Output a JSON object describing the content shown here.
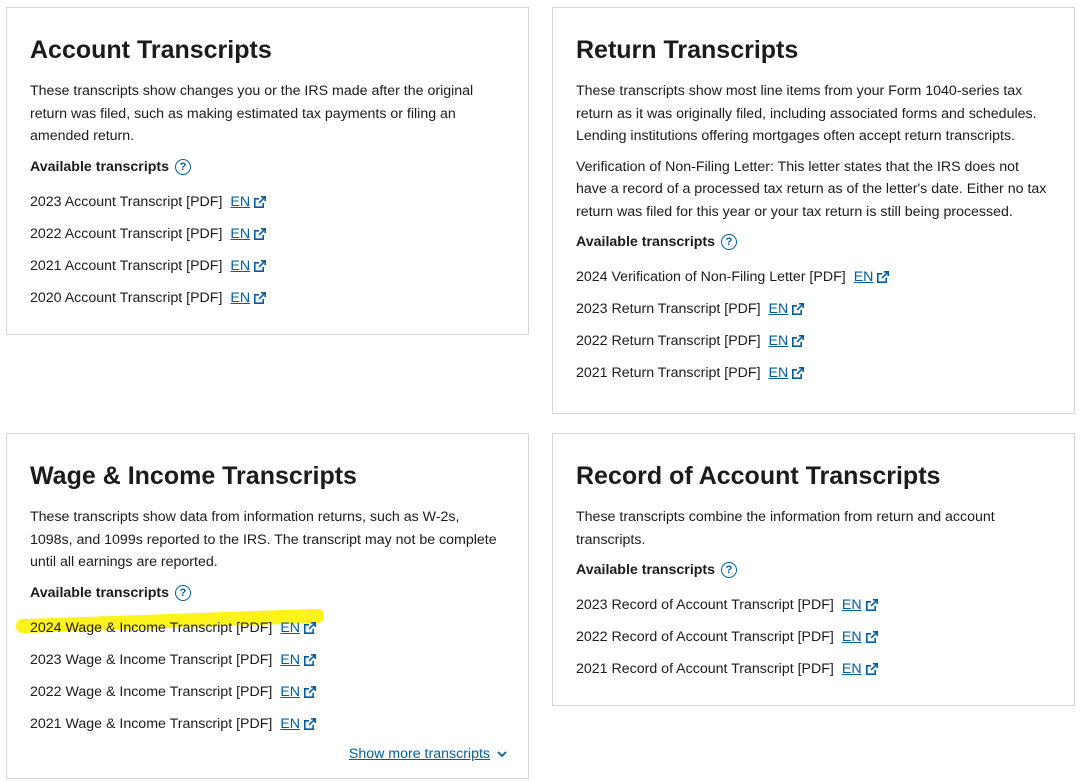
{
  "account": {
    "title": "Account Transcripts",
    "desc": "These transcripts show changes you or the IRS made after the original return was filed, such as making estimated tax payments or filing an amended return.",
    "avail_label": "Available transcripts",
    "items": [
      {
        "name": "2023 Account Transcript [PDF]",
        "link": "EN"
      },
      {
        "name": "2022 Account Transcript [PDF]",
        "link": "EN"
      },
      {
        "name": "2021 Account Transcript [PDF]",
        "link": "EN"
      },
      {
        "name": "2020 Account Transcript [PDF]",
        "link": "EN"
      }
    ]
  },
  "return": {
    "title": "Return Transcripts",
    "desc": "These transcripts show most line items from your Form 1040-series tax return as it was originally filed, including associated forms and schedules. Lending institutions offering mortgages often accept return transcripts.",
    "desc2": "Verification of Non-Filing Letter: This letter states that the IRS does not have a record of a processed tax return as of the letter's date. Either no tax return was filed for this year or your tax return is still being processed.",
    "avail_label": "Available transcripts",
    "items": [
      {
        "name": "2024 Verification of Non-Filing Letter [PDF]",
        "link": "EN"
      },
      {
        "name": "2023 Return Transcript [PDF]",
        "link": "EN"
      },
      {
        "name": "2022 Return Transcript [PDF]",
        "link": "EN"
      },
      {
        "name": "2021 Return Transcript [PDF]",
        "link": "EN"
      }
    ]
  },
  "wage": {
    "title": "Wage & Income Transcripts",
    "desc": "These transcripts show data from information returns, such as W-2s, 1098s, and 1099s reported to the IRS. The transcript may not be complete until all earnings are reported.",
    "avail_label": "Available transcripts",
    "items": [
      {
        "name": "2024 Wage & Income Transcript [PDF]",
        "link": "EN"
      },
      {
        "name": "2023 Wage & Income Transcript [PDF]",
        "link": "EN"
      },
      {
        "name": "2022 Wage & Income Transcript [PDF]",
        "link": "EN"
      },
      {
        "name": "2021 Wage & Income Transcript [PDF]",
        "link": "EN"
      }
    ],
    "show_more": "Show more transcripts"
  },
  "record": {
    "title": "Record of Account Transcripts",
    "desc": "These transcripts combine the information from return and account transcripts.",
    "avail_label": "Available transcripts",
    "items": [
      {
        "name": "2023 Record of Account Transcript [PDF]",
        "link": "EN"
      },
      {
        "name": "2022 Record of Account Transcript [PDF]",
        "link": "EN"
      },
      {
        "name": "2021 Record of Account Transcript [PDF]",
        "link": "EN"
      }
    ]
  },
  "colors": {
    "link": "#005ea2",
    "highlight": "#fdf31a",
    "border": "#d4d4d4"
  },
  "icons": {
    "help": "question-circle-icon",
    "external": "external-link-icon",
    "chevron": "chevron-down-icon"
  }
}
